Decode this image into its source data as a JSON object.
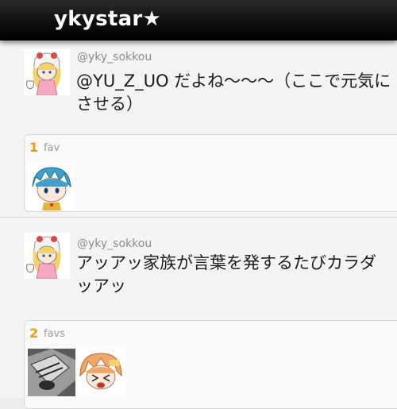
{
  "app": {
    "title": "ykystar★"
  },
  "tweets": [
    {
      "username": "@yky_sokkou",
      "text": "@YU_Z_UO だよね〜〜〜（ここで元気に\nさせる）",
      "fav_count": "1",
      "fav_label": "fav"
    },
    {
      "username": "@yky_sokkou",
      "text": "アッアッ家族が言葉を発するたびカラダ\nッアッ",
      "fav_count": "2",
      "fav_label": "favs"
    }
  ],
  "colors": {
    "accent": "#f29a12",
    "header": "#111111",
    "username": "#8a8a8a"
  }
}
